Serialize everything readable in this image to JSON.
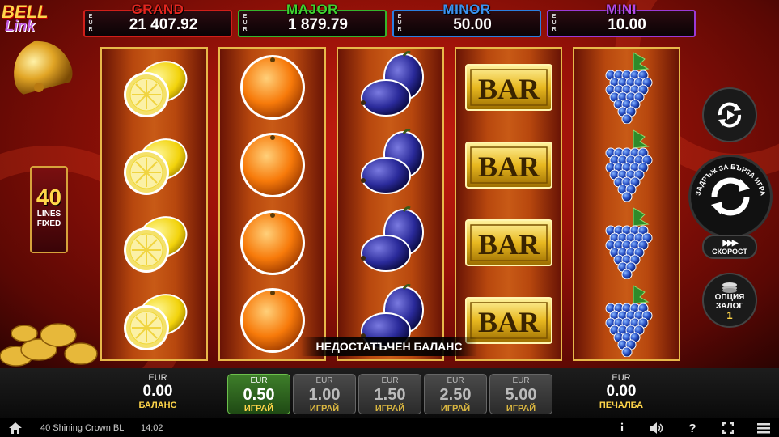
{
  "logo": {
    "line1": "BELL",
    "line2": "Link"
  },
  "jackpots": [
    {
      "title": "GRAND",
      "currency": [
        "E",
        "U",
        "R"
      ],
      "value": "21 407.92",
      "color": "#e3261f"
    },
    {
      "title": "MAJOR",
      "currency": [
        "E",
        "U",
        "R"
      ],
      "value": "1 879.79",
      "color": "#3ed22f"
    },
    {
      "title": "MINOR",
      "currency": [
        "E",
        "U",
        "R"
      ],
      "value": "50.00",
      "color": "#3b92f0"
    },
    {
      "title": "MINI",
      "currency": [
        "E",
        "U",
        "R"
      ],
      "value": "10.00",
      "color": "#b34ae6"
    }
  ],
  "lines": {
    "count": "40",
    "label1": "LINES",
    "label2": "FIXED"
  },
  "reels": [
    {
      "symbol": "lemon"
    },
    {
      "symbol": "orange"
    },
    {
      "symbol": "plum"
    },
    {
      "symbol": "bar",
      "label": "BAR"
    },
    {
      "symbol": "grapes"
    }
  ],
  "buttons": {
    "spin_hint": "ЗАДРЪЖ ЗА БЪРЗА ИГРА",
    "speed_label": "СКОРОСТ",
    "bet_option_line1": "ОПЦИЯ",
    "bet_option_line2": "ЗАЛОГ",
    "bet_option_value": "1"
  },
  "message": "НЕДОСТАТЪЧЕН БАЛАНС",
  "panel": {
    "balance": {
      "currency": "EUR",
      "value": "0.00",
      "label": "БАЛАНС"
    },
    "win": {
      "currency": "EUR",
      "value": "0.00",
      "label": "ПЕЧАЛБА"
    },
    "bets": [
      {
        "currency": "EUR",
        "value": "0.50",
        "label": "ИГРАЙ",
        "active": true
      },
      {
        "currency": "EUR",
        "value": "1.00",
        "label": "ИГРАЙ",
        "active": false
      },
      {
        "currency": "EUR",
        "value": "1.50",
        "label": "ИГРАЙ",
        "active": false
      },
      {
        "currency": "EUR",
        "value": "2.50",
        "label": "ИГРАЙ",
        "active": false
      },
      {
        "currency": "EUR",
        "value": "5.00",
        "label": "ИГРАЙ",
        "active": false
      }
    ]
  },
  "statusbar": {
    "game_name": "40 Shining Crown BL",
    "clock": "14:02",
    "icons": [
      "home-icon",
      "info-icon",
      "sound-icon",
      "help-icon",
      "fullscreen-icon",
      "menu-icon"
    ]
  }
}
